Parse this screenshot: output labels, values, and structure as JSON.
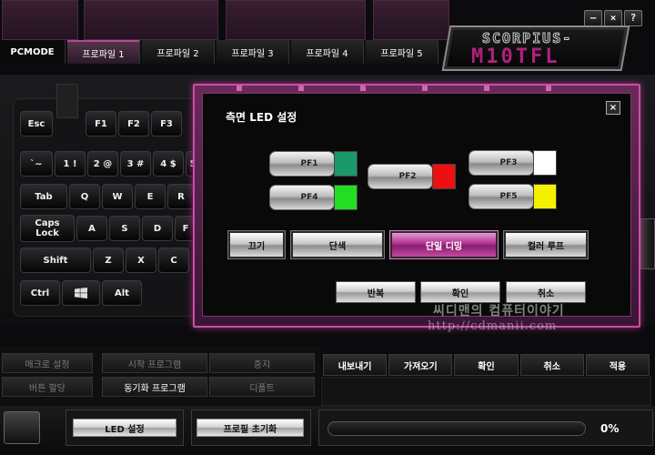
{
  "window": {
    "minimize": "–",
    "close": "×",
    "help": "?"
  },
  "logo": {
    "line1": "SCORPIUS-",
    "line2": "M10TFL"
  },
  "tabs": {
    "pcmode": "PCMODE",
    "profiles": [
      "프로파일 1",
      "프로파일 2",
      "프로파일 3",
      "프로파일 4",
      "프로파일 5"
    ],
    "active_index": 0
  },
  "keyboard": {
    "row1": [
      "Esc",
      "F1",
      "F2",
      "F3"
    ],
    "row2": [
      "`~",
      "1 !",
      "2 @",
      "3 #",
      "4 $",
      "5"
    ],
    "row3": [
      "Tab",
      "Q",
      "W",
      "E",
      "R"
    ],
    "row4": [
      "Caps Lock",
      "A",
      "S",
      "D",
      "F"
    ],
    "row5": [
      "Shift",
      "Z",
      "X",
      "C"
    ],
    "row6": [
      "Ctrl",
      "windows-icon",
      "Alt"
    ]
  },
  "dialog": {
    "title": "측면 LED 설정",
    "close": "×",
    "profiles": [
      {
        "label": "PF1",
        "color": "#1a9a6a"
      },
      {
        "label": "PF2",
        "color": "#ee1010"
      },
      {
        "label": "PF3",
        "color": "#ffffff"
      },
      {
        "label": "PF4",
        "color": "#22dd22"
      },
      {
        "label": "PF5",
        "color": "#f4f000"
      }
    ],
    "modes": [
      "끄기",
      "단색",
      "단일 디밍",
      "컬러 루프"
    ],
    "selected_mode": "단일 디밍",
    "actions": [
      "반복",
      "확인",
      "취소"
    ]
  },
  "left_menu": {
    "row1": [
      "매크로 설정",
      "시작 프로그램",
      "중지"
    ],
    "row2": [
      "버튼 할당",
      "동기화 프로그램",
      "디폴트"
    ]
  },
  "right_toolbar": [
    "내보내기",
    "가져오기",
    "확인",
    "취소",
    "적용"
  ],
  "bottom": {
    "led_settings": "LED 설정",
    "profile_reset": "프로필 초기화",
    "progress": 0,
    "progress_text": "0%"
  },
  "watermark": {
    "line1": "씨디맨의 컴퓨터이야기",
    "line2": "http://cdmanii.com"
  },
  "colors": {
    "accent": "#b0308e"
  }
}
